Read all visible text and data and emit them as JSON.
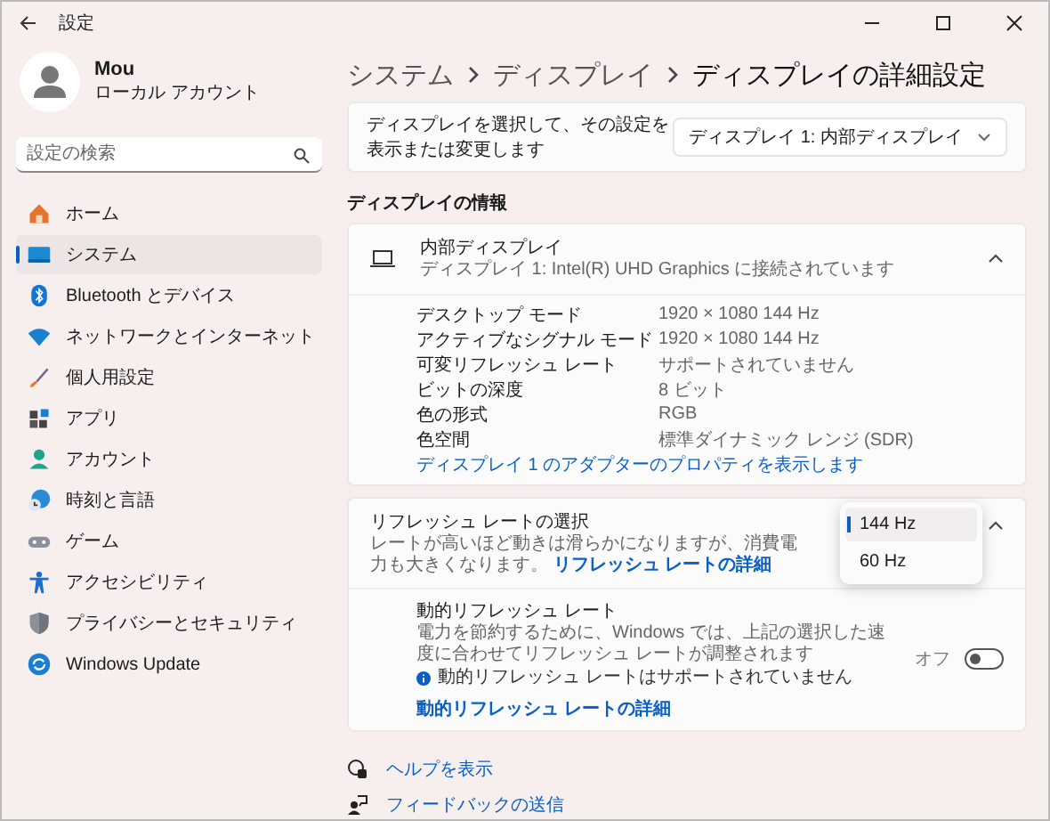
{
  "window": {
    "title": "設定"
  },
  "profile": {
    "name": "Mou",
    "account_type": "ローカル アカウント"
  },
  "search": {
    "placeholder": "設定の検索"
  },
  "sidebar": {
    "items": [
      {
        "label": "ホーム",
        "selected": false
      },
      {
        "label": "システム",
        "selected": true
      },
      {
        "label": "Bluetooth とデバイス",
        "selected": false
      },
      {
        "label": "ネットワークとインターネット",
        "selected": false
      },
      {
        "label": "個人用設定",
        "selected": false
      },
      {
        "label": "アプリ",
        "selected": false
      },
      {
        "label": "アカウント",
        "selected": false
      },
      {
        "label": "時刻と言語",
        "selected": false
      },
      {
        "label": "ゲーム",
        "selected": false
      },
      {
        "label": "アクセシビリティ",
        "selected": false
      },
      {
        "label": "プライバシーとセキュリティ",
        "selected": false
      },
      {
        "label": "Windows Update",
        "selected": false
      }
    ]
  },
  "breadcrumb": [
    "システム",
    "ディスプレイ",
    "ディスプレイの詳細設定"
  ],
  "display_select": {
    "label": "ディスプレイを選択して、その設定を表示または変更します",
    "value": "ディスプレイ 1: 内部ディスプレイ"
  },
  "section_heading": "ディスプレイの情報",
  "display_info": {
    "title": "内部ディスプレイ",
    "subtitle": "ディスプレイ 1: Intel(R) UHD Graphics に接続されています",
    "expanded": true,
    "rows": [
      {
        "label": "デスクトップ モード",
        "value": "1920 × 1080 144 Hz"
      },
      {
        "label": "アクティブなシグナル モード",
        "value": "1920 × 1080 144 Hz"
      },
      {
        "label": "可変リフレッシュ レート",
        "value": "サポートされていません"
      },
      {
        "label": "ビットの深度",
        "value": "8 ビット"
      },
      {
        "label": "色の形式",
        "value": "RGB"
      },
      {
        "label": "色空間",
        "value": "標準ダイナミック レンジ (SDR)"
      }
    ],
    "link": "ディスプレイ 1 のアダプターのプロパティを表示します"
  },
  "refresh_rate": {
    "title": "リフレッシュ レートの選択",
    "description": "レートが高いほど動きは滑らかになりますが、消費電力も大きくなります。",
    "link": "リフレッシュ レートの詳細",
    "expanded": true,
    "options": [
      {
        "label": "144 Hz",
        "selected": true
      },
      {
        "label": "60 Hz",
        "selected": false
      }
    ],
    "dynamic": {
      "title": "動的リフレッシュ レート",
      "description": "電力を節約するために、Windows では、上記の選択した速度に合わせてリフレッシュ レートが調整されます",
      "on": false,
      "state_label": "オフ",
      "info": "動的リフレッシュ レートはサポートされていません",
      "info_link": "動的リフレッシュ レートの詳細"
    }
  },
  "help_links": [
    "ヘルプを表示",
    "フィードバックの送信"
  ]
}
